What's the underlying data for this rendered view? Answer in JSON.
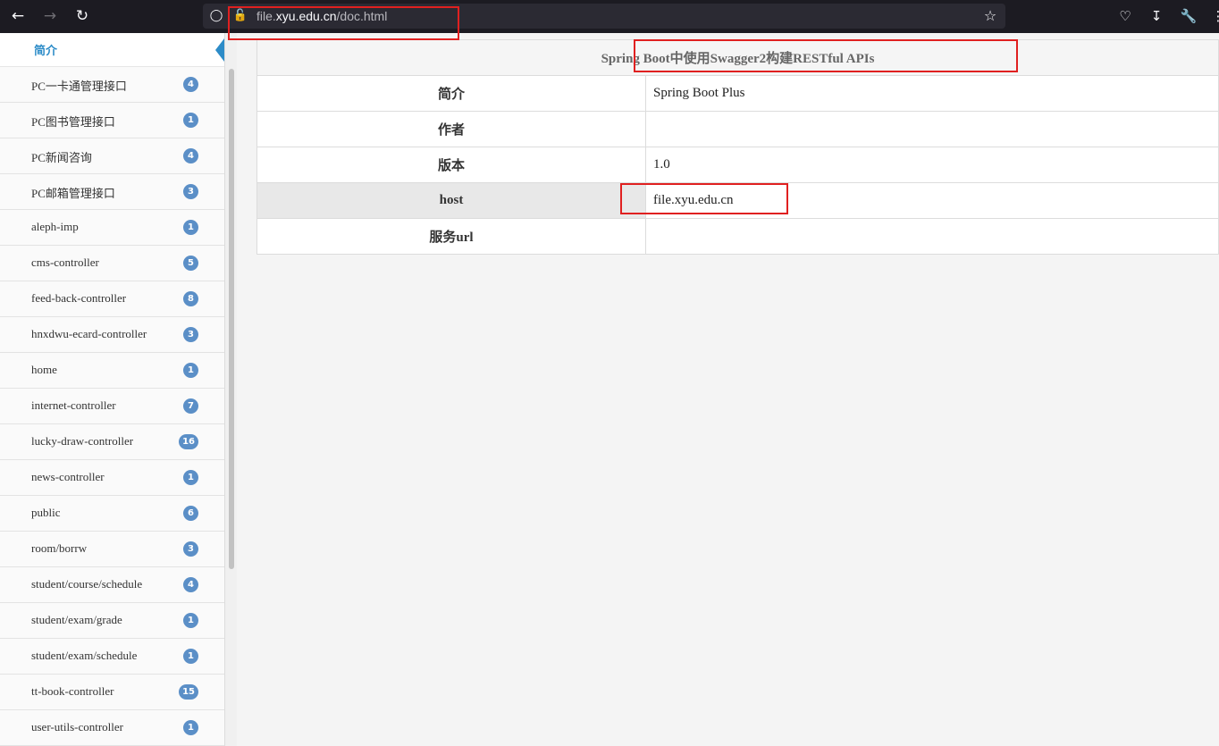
{
  "browser": {
    "url_prefix": "file.",
    "url_domain": "xyu.edu.cn",
    "url_path": "/doc.html"
  },
  "sidebar": {
    "header": "简介",
    "items": [
      {
        "label": "PC一卡通管理接口",
        "count": "4"
      },
      {
        "label": "PC图书管理接口",
        "count": "1"
      },
      {
        "label": "PC新闻咨询",
        "count": "4"
      },
      {
        "label": "PC邮箱管理接口",
        "count": "3"
      },
      {
        "label": "aleph-imp",
        "count": "1"
      },
      {
        "label": "cms-controller",
        "count": "5"
      },
      {
        "label": "feed-back-controller",
        "count": "8"
      },
      {
        "label": "hnxdwu-ecard-controller",
        "count": "3"
      },
      {
        "label": "home",
        "count": "1"
      },
      {
        "label": "internet-controller",
        "count": "7"
      },
      {
        "label": "lucky-draw-controller",
        "count": "16"
      },
      {
        "label": "news-controller",
        "count": "1"
      },
      {
        "label": "public",
        "count": "6"
      },
      {
        "label": "room/borrw",
        "count": "3"
      },
      {
        "label": "student/course/schedule",
        "count": "4"
      },
      {
        "label": "student/exam/grade",
        "count": "1"
      },
      {
        "label": "student/exam/schedule",
        "count": "1"
      },
      {
        "label": "tt-book-controller",
        "count": "15"
      },
      {
        "label": "user-utils-controller",
        "count": "1"
      }
    ]
  },
  "main": {
    "title": "Spring Boot中使用Swagger2构建RESTful APIs",
    "rows": [
      {
        "key": "简介",
        "value": "Spring Boot Plus"
      },
      {
        "key": "作者",
        "value": ""
      },
      {
        "key": "版本",
        "value": "1.0"
      },
      {
        "key": "host",
        "value": "file.xyu.edu.cn"
      },
      {
        "key": "服务url",
        "value": ""
      }
    ]
  }
}
